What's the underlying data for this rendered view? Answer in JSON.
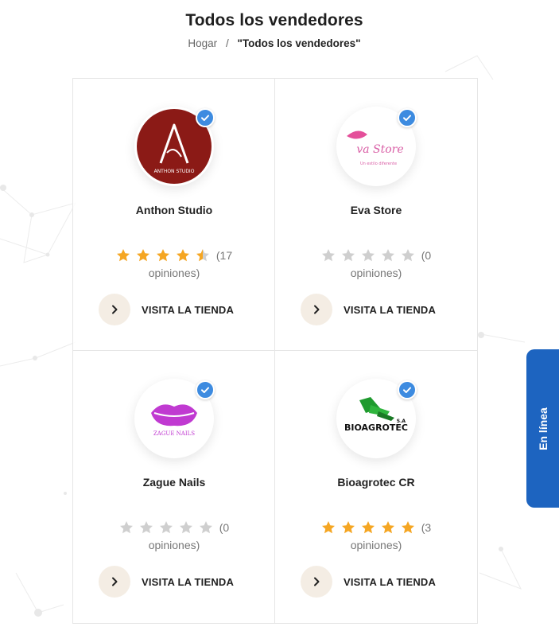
{
  "page": {
    "title": "Todos los vendedores",
    "breadcrumb": {
      "home": "Hogar",
      "separator": "/",
      "current": "\"Todos los vendedores\""
    }
  },
  "vendors": [
    {
      "name": "Anthon Studio",
      "rating": 4.5,
      "review_count": "(17",
      "reviews_word": "opiniones)",
      "verified": true,
      "visit_label": "VISITA LA TIENDA",
      "logo_text": "ANTHON STUDIO"
    },
    {
      "name": "Eva Store",
      "rating": 0,
      "review_count": "(0",
      "reviews_word": "opiniones)",
      "verified": true,
      "visit_label": "VISITA LA TIENDA",
      "logo_text": "va Store",
      "logo_subtext": "Un estilo diferente"
    },
    {
      "name": "Zague Nails",
      "rating": 0,
      "review_count": "(0",
      "reviews_word": "opiniones)",
      "verified": true,
      "visit_label": "VISITA LA TIENDA",
      "logo_text": "ZAGUE NAILS"
    },
    {
      "name": "Bioagrotec CR",
      "rating": 5,
      "review_count": "(3",
      "reviews_word": "opiniones)",
      "verified": true,
      "visit_label": "VISITA LA TIENDA",
      "logo_text": "BIOAGROTEC",
      "logo_subtext": "S.A"
    }
  ],
  "online_tab": {
    "label": "En línea"
  },
  "colors": {
    "star_filled": "#f5a623",
    "star_empty": "#cfcfcf",
    "verified": "#3d8be0",
    "online_tab": "#1d64c0",
    "arrow_bg": "#f4ede4"
  }
}
